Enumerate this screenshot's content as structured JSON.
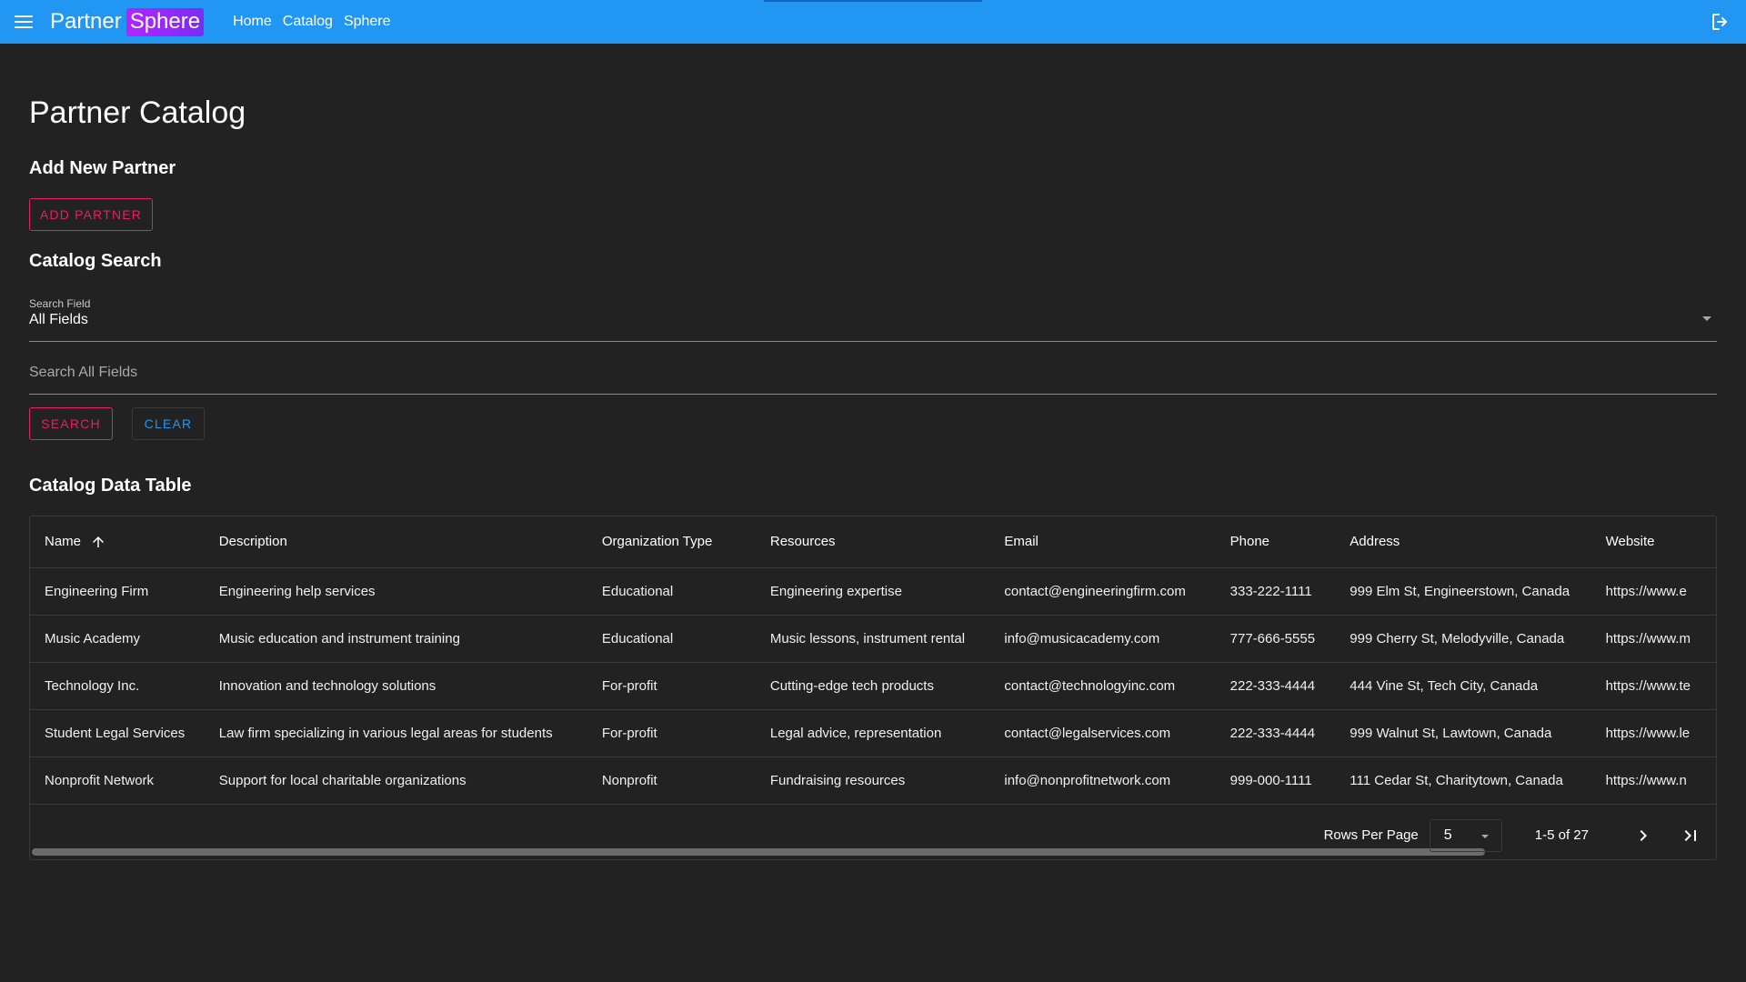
{
  "appbar": {
    "brand_part1": "Partner",
    "brand_part2": "Sphere",
    "nav": [
      "Home",
      "Catalog",
      "Sphere"
    ]
  },
  "page": {
    "title": "Partner Catalog",
    "add_heading": "Add New Partner",
    "add_button": "ADD PARTNER",
    "search_heading": "Catalog Search",
    "search_field_label": "Search Field",
    "search_field_value": "All Fields",
    "search_placeholder": "Search All Fields",
    "search_button": "SEARCH",
    "clear_button": "CLEAR",
    "table_heading": "Catalog Data Table"
  },
  "table": {
    "columns": [
      "Name",
      "Description",
      "Organization Type",
      "Resources",
      "Email",
      "Phone",
      "Address",
      "Website"
    ],
    "rows": [
      [
        "Engineering Firm",
        "Engineering help services",
        "Educational",
        "Engineering expertise",
        "contact@engineeringfirm.com",
        "333-222-1111",
        "999 Elm St, Engineerstown, Canada",
        "https://www.e"
      ],
      [
        "Music Academy",
        "Music education and instrument training",
        "Educational",
        "Music lessons, instrument rental",
        "info@musicacademy.com",
        "777-666-5555",
        "999 Cherry St, Melodyville, Canada",
        "https://www.m"
      ],
      [
        "Technology Inc.",
        "Innovation and technology solutions",
        "For-profit",
        "Cutting-edge tech products",
        "contact@technologyinc.com",
        "222-333-4444",
        "444 Vine St, Tech City, Canada",
        "https://www.te"
      ],
      [
        "Student Legal Services",
        "Law firm specializing in various legal areas for students",
        "For-profit",
        "Legal advice, representation",
        "contact@legalservices.com",
        "222-333-4444",
        "999 Walnut St, Lawtown, Canada",
        "https://www.le"
      ],
      [
        "Nonprofit Network",
        "Support for local charitable organizations",
        "Nonprofit",
        "Fundraising resources",
        "info@nonprofitnetwork.com",
        "999-000-1111",
        "111 Cedar St, Charitytown, Canada",
        "https://www.n"
      ]
    ],
    "rows_per_page_label": "Rows Per Page",
    "rows_per_page_value": "5",
    "range_text": "1-5 of 27"
  },
  "colors": {
    "appbar": "#2196f3",
    "background": "#222222",
    "accent_pink": "#e91e63",
    "accent_blue": "#2196f3",
    "brand_highlight": "#8b2cf5"
  },
  "icons": [
    "menu-icon",
    "logout-icon",
    "sort-arrow-up-icon",
    "chevron-right-icon",
    "last-page-icon"
  ]
}
